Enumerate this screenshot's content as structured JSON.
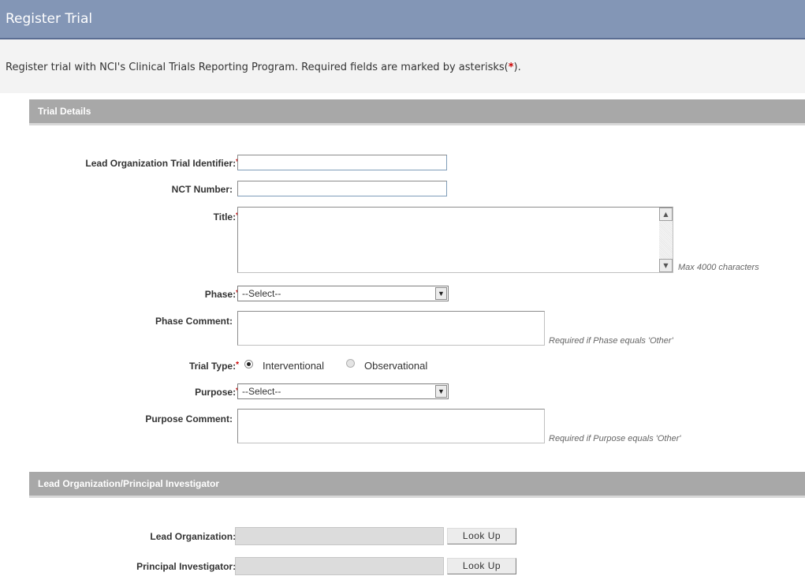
{
  "page": {
    "title": "Register Trial",
    "intro_text": "Register trial with NCI's Clinical Trials Reporting Program. Required fields are marked by asterisks(",
    "intro_asterisk": "*",
    "intro_end": ")."
  },
  "sections": {
    "trial_details": "Trial Details",
    "lead_org_pi": "Lead Organization/Principal Investigator"
  },
  "required_marker": "*",
  "fields": {
    "lead_org_trial_id": {
      "label": "Lead Organization Trial Identifier:",
      "value": ""
    },
    "nct_number": {
      "label": "NCT Number:",
      "value": ""
    },
    "title": {
      "label": "Title:",
      "value": "",
      "hint": "Max 4000 characters"
    },
    "phase": {
      "label": "Phase:",
      "selected": "--Select--"
    },
    "phase_comment": {
      "label": "Phase Comment:",
      "value": "",
      "hint": "Required if Phase equals 'Other'"
    },
    "trial_type": {
      "label": "Trial Type:",
      "options": [
        "Interventional",
        "Observational"
      ],
      "selected": "Interventional"
    },
    "purpose": {
      "label": "Purpose:",
      "selected": "--Select--"
    },
    "purpose_comment": {
      "label": "Purpose Comment:",
      "value": "",
      "hint": "Required if Purpose equals 'Other'"
    },
    "lead_organization": {
      "label": "Lead Organization:",
      "button": "Look Up"
    },
    "principal_investigator": {
      "label": "Principal Investigator:",
      "button": "Look Up"
    }
  },
  "icons": {
    "scroll_up": "▲",
    "scroll_down": "▼",
    "dropdown": "▼"
  },
  "colors": {
    "banner": "#8396b6",
    "section_header": "#a8a8a8",
    "required": "#cc0000"
  }
}
